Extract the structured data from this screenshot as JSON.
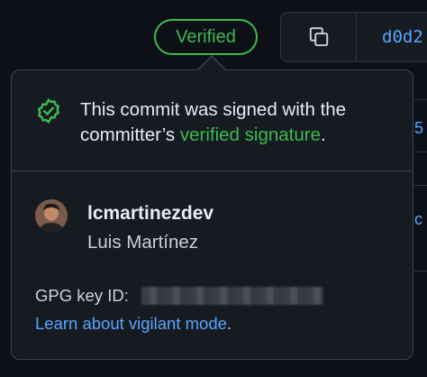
{
  "header": {
    "verified_label": "Verified",
    "commit_sha_short": "d0d2",
    "copy_icon": "copy-icon"
  },
  "background": {
    "peek_char_1": "5",
    "peek_char_2": "c"
  },
  "popover": {
    "message_prefix": "This commit was signed with the committer’s ",
    "message_link": "verified signature",
    "message_suffix": ".",
    "username": "lcmartinezdev",
    "full_name": "Luis Martínez",
    "gpg_label": "GPG key ID:",
    "learn_link": "Learn about vigilant mode",
    "learn_suffix": "."
  },
  "colors": {
    "verified_green": "#3fb950",
    "link_blue": "#58a6ff",
    "popover_bg": "#161b22",
    "page_bg": "#0d1117"
  }
}
